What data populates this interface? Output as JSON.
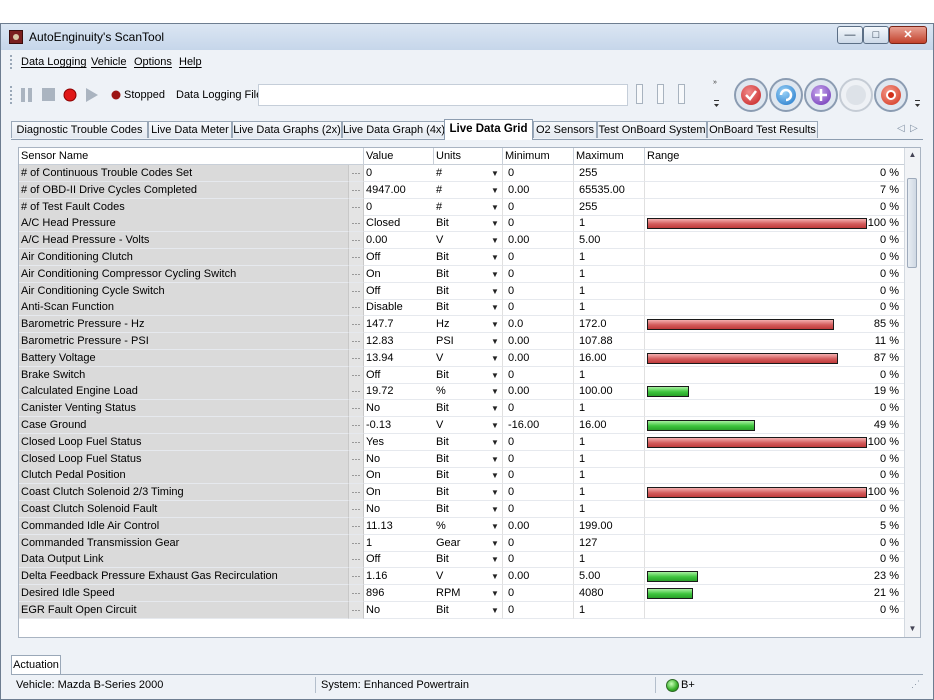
{
  "window": {
    "title": "AutoEnginuity's ScanTool",
    "buttons": {
      "minimize": "—",
      "maximize": "□",
      "close": "✕"
    }
  },
  "menu": [
    "Data Logging",
    "Vehicle",
    "Options",
    "Help"
  ],
  "toolbar": {
    "status": "Stopped",
    "log_file_label": "Data Logging File",
    "log_file_value": ""
  },
  "tabs": [
    {
      "label": "Diagnostic Trouble Codes",
      "active": false
    },
    {
      "label": "Live Data Meter",
      "active": false
    },
    {
      "label": "Live Data Graphs (2x)",
      "active": false
    },
    {
      "label": "Live Data Graph (4x)",
      "active": false
    },
    {
      "label": "Live Data Grid",
      "active": true
    },
    {
      "label": "O2 Sensors",
      "active": false
    },
    {
      "label": "Test OnBoard System",
      "active": false
    },
    {
      "label": "OnBoard Test Results",
      "active": false
    }
  ],
  "grid": {
    "headers": {
      "name": "Sensor Name",
      "value": "Value",
      "units": "Units",
      "minimum": "Minimum",
      "maximum": "Maximum",
      "range": "Range"
    },
    "rows": [
      {
        "name": "# of Continuous Trouble Codes Set",
        "value": "0",
        "units": "#",
        "min": "0",
        "max": "255",
        "pct": 0,
        "pct_text": "0 %",
        "color": ""
      },
      {
        "name": "# of OBD-II Drive Cycles Completed",
        "value": "4947.00",
        "units": "#",
        "min": "0.00",
        "max": "65535.00",
        "pct": 7,
        "pct_text": "7 %",
        "color": ""
      },
      {
        "name": "# of Test Fault Codes",
        "value": "0",
        "units": "#",
        "min": "0",
        "max": "255",
        "pct": 0,
        "pct_text": "0 %",
        "color": ""
      },
      {
        "name": "A/C Head Pressure",
        "value": "Closed",
        "units": "Bit",
        "min": "0",
        "max": "1",
        "pct": 100,
        "pct_text": "100 %",
        "color": "red"
      },
      {
        "name": "A/C Head Pressure - Volts",
        "value": "0.00",
        "units": "V",
        "min": "0.00",
        "max": "5.00",
        "pct": 0,
        "pct_text": "0 %",
        "color": ""
      },
      {
        "name": "Air Conditioning Clutch",
        "value": "Off",
        "units": "Bit",
        "min": "0",
        "max": "1",
        "pct": 0,
        "pct_text": "0 %",
        "color": ""
      },
      {
        "name": "Air Conditioning Compressor Cycling Switch",
        "value": "On",
        "units": "Bit",
        "min": "0",
        "max": "1",
        "pct": 0,
        "pct_text": "0 %",
        "color": ""
      },
      {
        "name": "Air Conditioning Cycle Switch",
        "value": "Off",
        "units": "Bit",
        "min": "0",
        "max": "1",
        "pct": 0,
        "pct_text": "0 %",
        "color": ""
      },
      {
        "name": "Anti-Scan Function",
        "value": "Disable",
        "units": "Bit",
        "min": "0",
        "max": "1",
        "pct": 0,
        "pct_text": "0 %",
        "color": ""
      },
      {
        "name": "Barometric Pressure - Hz",
        "value": "147.7",
        "units": "Hz",
        "min": "0.0",
        "max": "172.0",
        "pct": 85,
        "pct_text": "85 %",
        "color": "red"
      },
      {
        "name": "Barometric Pressure - PSI",
        "value": "12.83",
        "units": "PSI",
        "min": "0.00",
        "max": "107.88",
        "pct": 11,
        "pct_text": "11 %",
        "color": ""
      },
      {
        "name": "Battery Voltage",
        "value": "13.94",
        "units": "V",
        "min": "0.00",
        "max": "16.00",
        "pct": 87,
        "pct_text": "87 %",
        "color": "red"
      },
      {
        "name": "Brake Switch",
        "value": "Off",
        "units": "Bit",
        "min": "0",
        "max": "1",
        "pct": 0,
        "pct_text": "0 %",
        "color": ""
      },
      {
        "name": "Calculated Engine Load",
        "value": "19.72",
        "units": "%",
        "min": "0.00",
        "max": "100.00",
        "pct": 19,
        "pct_text": "19 %",
        "color": "green"
      },
      {
        "name": "Canister Venting Status",
        "value": "No",
        "units": "Bit",
        "min": "0",
        "max": "1",
        "pct": 0,
        "pct_text": "0 %",
        "color": ""
      },
      {
        "name": "Case Ground",
        "value": "-0.13",
        "units": "V",
        "min": "-16.00",
        "max": "16.00",
        "pct": 49,
        "pct_text": "49 %",
        "color": "green"
      },
      {
        "name": "Closed Loop Fuel Status",
        "value": "Yes",
        "units": "Bit",
        "min": "0",
        "max": "1",
        "pct": 100,
        "pct_text": "100 %",
        "color": "red"
      },
      {
        "name": "Closed Loop Fuel Status",
        "value": "No",
        "units": "Bit",
        "min": "0",
        "max": "1",
        "pct": 0,
        "pct_text": "0 %",
        "color": ""
      },
      {
        "name": "Clutch Pedal Position",
        "value": "On",
        "units": "Bit",
        "min": "0",
        "max": "1",
        "pct": 0,
        "pct_text": "0 %",
        "color": ""
      },
      {
        "name": "Coast Clutch Solenoid 2/3 Timing",
        "value": "On",
        "units": "Bit",
        "min": "0",
        "max": "1",
        "pct": 100,
        "pct_text": "100 %",
        "color": "red"
      },
      {
        "name": "Coast Clutch Solenoid Fault",
        "value": "No",
        "units": "Bit",
        "min": "0",
        "max": "1",
        "pct": 0,
        "pct_text": "0 %",
        "color": ""
      },
      {
        "name": "Commanded Idle Air Control",
        "value": "11.13",
        "units": "%",
        "min": "0.00",
        "max": "199.00",
        "pct": 5,
        "pct_text": "5 %",
        "color": ""
      },
      {
        "name": "Commanded Transmission Gear",
        "value": "1",
        "units": "Gear",
        "min": "0",
        "max": "127",
        "pct": 0,
        "pct_text": "0 %",
        "color": ""
      },
      {
        "name": "Data Output Link",
        "value": "Off",
        "units": "Bit",
        "min": "0",
        "max": "1",
        "pct": 0,
        "pct_text": "0 %",
        "color": ""
      },
      {
        "name": "Delta Feedback Pressure Exhaust Gas Recirculation",
        "value": "1.16",
        "units": "V",
        "min": "0.00",
        "max": "5.00",
        "pct": 23,
        "pct_text": "23 %",
        "color": "green"
      },
      {
        "name": "Desired Idle Speed",
        "value": "896",
        "units": "RPM",
        "min": "0",
        "max": "4080",
        "pct": 21,
        "pct_text": "21 %",
        "color": "green"
      },
      {
        "name": "EGR Fault Open Circuit",
        "value": "No",
        "units": "Bit",
        "min": "0",
        "max": "1",
        "pct": 0,
        "pct_text": "0 %",
        "color": ""
      }
    ]
  },
  "bottom_tab": "Actuation",
  "status": {
    "vehicle": "Vehicle: Mazda  B-Series  2000",
    "system": "System: Enhanced Powertrain",
    "protocol": "B+"
  }
}
